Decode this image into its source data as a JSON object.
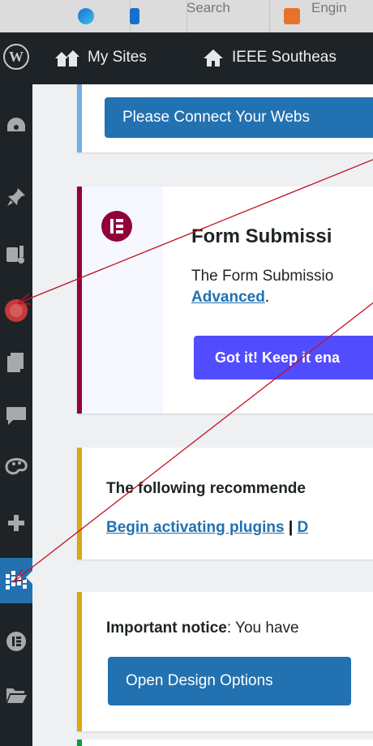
{
  "browser_tabs": [
    {
      "label": "",
      "icon": "edge-icon"
    },
    {
      "label": "",
      "icon": "bing-icon"
    },
    {
      "label": "Search",
      "icon": ""
    },
    {
      "label": "Engin",
      "icon": "app-icon"
    }
  ],
  "admin_bar": {
    "my_sites": "My Sites",
    "site_name": "IEEE Southeas"
  },
  "sidebar": {
    "items": [
      "dashboard-icon",
      "pin-icon",
      "media-icon",
      "plugin-alert-icon",
      "pages-icon",
      "comments-icon",
      "appearance-icon",
      "plus-icon",
      "grid-chart-icon",
      "elementor-icon",
      "folder-icon"
    ],
    "active": "grid-chart-icon"
  },
  "notices": {
    "connect": {
      "button": "Please Connect Your Webs"
    },
    "form_submission": {
      "title": "Form Submissi",
      "text": "The Form Submissio",
      "link": "Advanced",
      "link_suffix": ".",
      "button": "Got it! Keep it ena"
    },
    "recommended": {
      "text": "The following recommende",
      "link1": "Begin activating plugins",
      "separator": " | ",
      "link2": "D"
    },
    "important": {
      "label": "Important notice",
      "text": ": You have",
      "button": "Open Design Options"
    }
  },
  "colors": {
    "admin_bar": "#1d2327",
    "wp_blue": "#2271b1",
    "elementor_maroon": "#92003b",
    "elementor_button": "#524cff",
    "warning_yellow": "#dba617",
    "success_green": "#00a32a",
    "annotation_red": "#c2121f"
  }
}
